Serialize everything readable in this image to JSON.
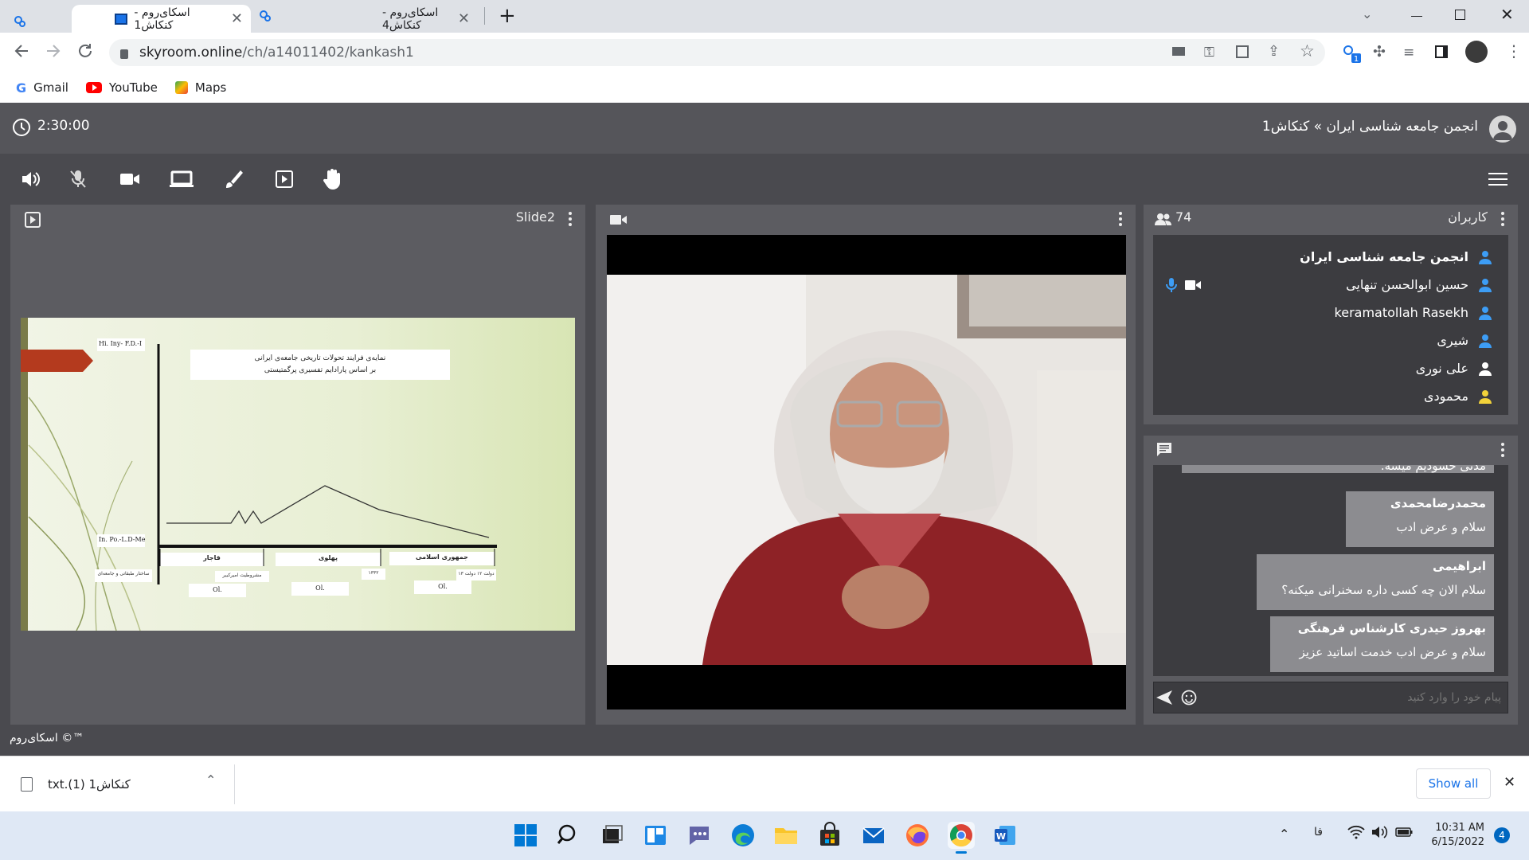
{
  "browser": {
    "tabs": [
      {
        "title": "اسکای‌روم - کنکاش1",
        "active": true
      },
      {
        "title": "اسکای‌روم - کنکاش4",
        "active": false
      }
    ],
    "url_domain": "skyroom.online",
    "url_path": "/ch/a14011402/kankash1",
    "bookmarks": [
      "Gmail",
      "YouTube",
      "Maps"
    ]
  },
  "app": {
    "timer": "2:30:00",
    "breadcrumb": "انجمن جامعه شناسی ایران » کنکاش1",
    "slide_panel_title": "Slide2",
    "users_panel_title": "کاربران",
    "user_count": "74",
    "users": [
      {
        "name": "انجمن جامعه شناسی ایران",
        "bold": true,
        "icon_color": "#3d9df5"
      },
      {
        "name": "حسین ابوالحسن تنهایی",
        "bold": false,
        "icon_color": "#3d9df5",
        "mic": true,
        "cam": true
      },
      {
        "name": "keramatollah Rasekh",
        "bold": false,
        "icon_color": "#3d9df5"
      },
      {
        "name": "شیری",
        "bold": false,
        "icon_color": "#3d9df5"
      },
      {
        "name": "علی نوری",
        "bold": false,
        "icon_color": "#ffffff"
      },
      {
        "name": "محمودی",
        "bold": false,
        "icon_color": "#f2d23a"
      }
    ],
    "chat": {
      "partial_message": "مدنی حسودیم میشه.",
      "messages": [
        {
          "author": "محمدرضامحمدی",
          "text": "سلام و عرض ادب"
        },
        {
          "author": "ابراهیمی",
          "text": "سلام الان چه کسی داره سخنرانی میکنه؟"
        },
        {
          "author": "بهروز حیدری کارشناس فرهنگی",
          "text": "سلام و عرض ادب خدمت اساتید عزیز"
        }
      ],
      "input_placeholder": "پیام خود را وارد کنید"
    },
    "footer": "اسکای‌روم ©™"
  },
  "slide": {
    "title_line1": "نمایه‌ی فرایند تحولات تاریخی جامعه‌ی ایرانی",
    "title_line2": "بر اساس پارادایم تفسیری پرگمتیستی",
    "y_top_label": "Hi. Iny- F.D.-I",
    "y_bottom_label": "In. Po.-L.D-Me",
    "eras": [
      "قاجار",
      "پهلوی",
      "جمهوری اسلامی"
    ],
    "left_note": "ساختار طبقاتی و جامعه‌ای",
    "sub_note_1": "مشروطیت امیرکبیر",
    "sub_note_2": "۱۳۳۲",
    "sub_note_3": "دولت ۱۲ دولت ۱۳",
    "ol": [
      "Ol.",
      "Ol.",
      "Ol."
    ]
  },
  "downloads": {
    "file": "کنکاش1 (1).txt",
    "show_all": "Show all"
  },
  "taskbar": {
    "lang": "فا",
    "time": "10:31 AM",
    "date": "6/15/2022",
    "notifications": "4"
  }
}
